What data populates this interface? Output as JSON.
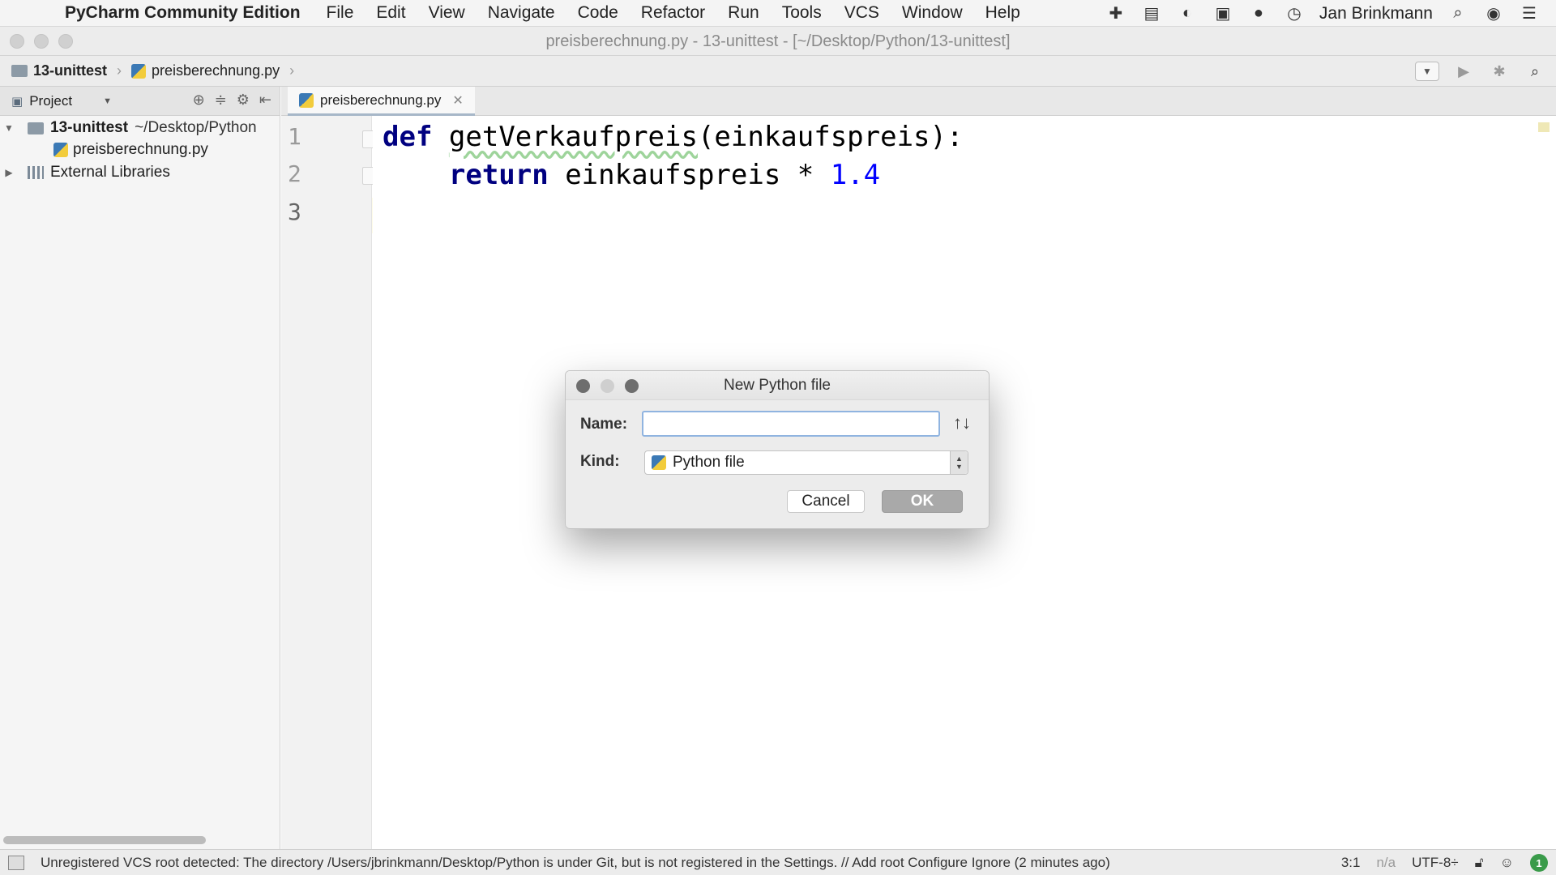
{
  "menubar": {
    "app_name": "PyCharm Community Edition",
    "items": [
      "File",
      "Edit",
      "View",
      "Navigate",
      "Code",
      "Refactor",
      "Run",
      "Tools",
      "VCS",
      "Window",
      "Help"
    ],
    "user": "Jan Brinkmann"
  },
  "window": {
    "title": "preisberechnung.py - 13-unittest - [~/Desktop/Python/13-unittest]"
  },
  "navbar": {
    "breadcrumbs": [
      "13-unittest",
      "preisberechnung.py"
    ]
  },
  "project_panel": {
    "header": "Project",
    "root_name": "13-unittest",
    "root_path": "~/Desktop/Python",
    "file": "preisberechnung.py",
    "external_libraries": "External Libraries"
  },
  "editor": {
    "tab": "preisberechnung.py",
    "line_numbers": [
      "1",
      "2",
      "3"
    ],
    "code": {
      "l1_kw": "def",
      "l1_fn": "getVerkaufpreis",
      "l1_rest": "(einkaufspreis):",
      "l2_kw": "return",
      "l2_rest": " einkaufspreis * ",
      "l2_num": "1.4"
    }
  },
  "dialog": {
    "title": "New Python file",
    "name_label": "Name:",
    "name_value": "",
    "kind_label": "Kind:",
    "kind_value": "Python file",
    "cancel": "Cancel",
    "ok": "OK",
    "sort_glyph": "↑↓"
  },
  "statusbar": {
    "message": "Unregistered VCS root detected: The directory /Users/jbrinkmann/Desktop/Python is under Git, but is not registered in the Settings. // Add root  Configure  Ignore (2 minutes ago)",
    "position": "3:1",
    "na": "n/a",
    "encoding": "UTF-8÷",
    "notifications": "1"
  }
}
